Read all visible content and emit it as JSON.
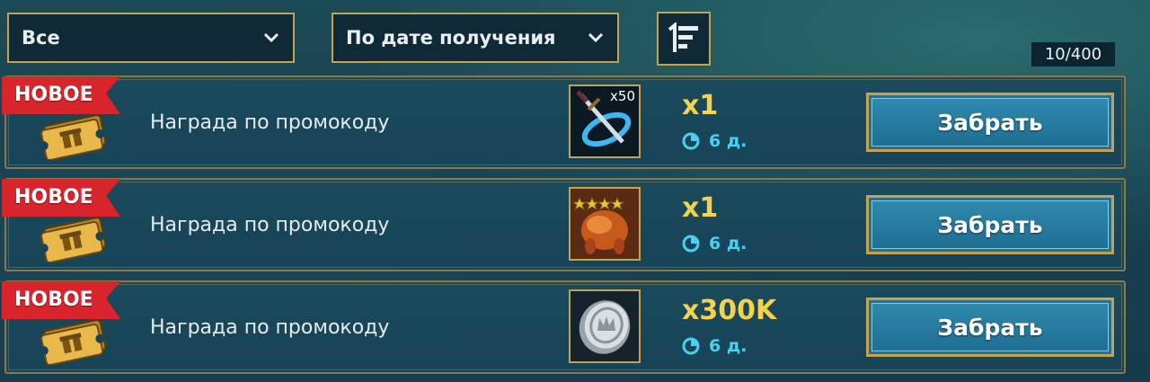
{
  "filters": {
    "category": "Все",
    "sort": "По дате получения"
  },
  "counter": "10/400",
  "rewards": [
    {
      "badge": "НОВОЕ",
      "title": "Награда по промокоду",
      "item_icon": "sword-item-icon",
      "item_label": "x50",
      "quantity": "x1",
      "time_left": "6 д.",
      "button": "Забрать"
    },
    {
      "badge": "НОВОЕ",
      "title": "Награда по промокоду",
      "item_icon": "chicken-item-icon",
      "item_stars": 4,
      "quantity": "x1",
      "time_left": "6 д.",
      "button": "Забрать"
    },
    {
      "badge": "НОВОЕ",
      "title": "Награда по промокоду",
      "item_icon": "silver-coin-icon",
      "quantity": "x300K",
      "time_left": "6 д.",
      "button": "Забрать"
    }
  ],
  "colors": {
    "gold_border": "#c4a350",
    "badge_red": "#d8242b",
    "quantity_yellow": "#f4d24c",
    "timer_cyan": "#4ad0f0",
    "button_blue": "#2f89ad"
  }
}
